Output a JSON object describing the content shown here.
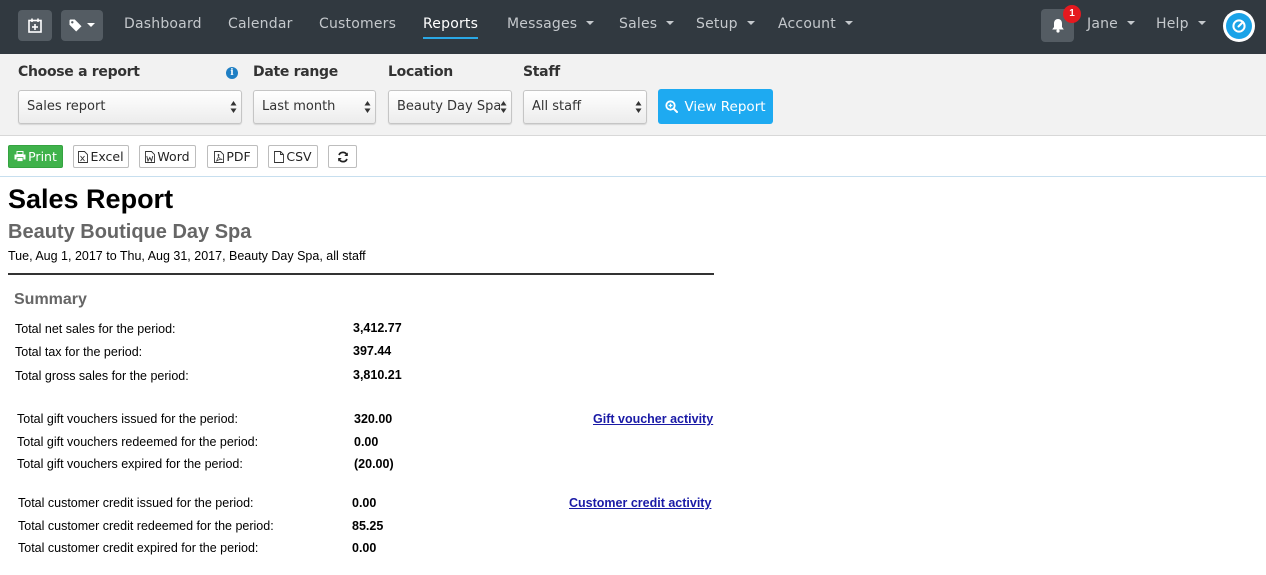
{
  "nav": {
    "items": [
      {
        "label": "Dashboard"
      },
      {
        "label": "Calendar"
      },
      {
        "label": "Customers"
      },
      {
        "label": "Reports",
        "active": true
      },
      {
        "label": "Messages"
      },
      {
        "label": "Sales"
      },
      {
        "label": "Setup"
      },
      {
        "label": "Account"
      }
    ],
    "notification_count": "1",
    "user": "Jane",
    "help": "Help"
  },
  "filters": {
    "report_label": "Choose a report",
    "report_value": "Sales report",
    "date_label": "Date range",
    "date_value": "Last month",
    "location_label": "Location",
    "location_value": "Beauty Day Spa",
    "staff_label": "Staff",
    "staff_value": "All staff",
    "view_button": "View Report"
  },
  "toolbar": {
    "print": "Print",
    "excel": "Excel",
    "word": "Word",
    "pdf": "PDF",
    "csv": "CSV"
  },
  "report": {
    "title": "Sales Report",
    "business": "Beauty Boutique Day Spa",
    "range": "Tue, Aug 1, 2017 to Thu, Aug 31, 2017, Beauty Day Spa, all staff",
    "summary_heading": "Summary",
    "sales": [
      {
        "label": "Total net sales for the period:",
        "value": "3,412.77"
      },
      {
        "label": "Total tax for the period:",
        "value": "397.44"
      },
      {
        "label": "Total gross sales for the period:",
        "value": "3,810.21"
      }
    ],
    "vouchers": [
      {
        "label": "Total gift vouchers issued for the period:",
        "value": "320.00"
      },
      {
        "label": "Total gift vouchers redeemed for the period:",
        "value": "0.00"
      },
      {
        "label": "Total gift vouchers expired for the period:",
        "value": "(20.00)"
      }
    ],
    "voucher_link": "Gift voucher activity",
    "credit": [
      {
        "label": "Total customer credit issued for the period:",
        "value": "0.00"
      },
      {
        "label": "Total customer credit redeemed for the period:",
        "value": "85.25"
      },
      {
        "label": "Total customer credit expired for the period:",
        "value": "0.00"
      }
    ],
    "credit_link": "Customer credit activity"
  },
  "colors": {
    "navbar": "#313940",
    "accent": "#1eaaf1",
    "print_green": "#3fb24b",
    "badge_red": "#e5191f",
    "link": "#1a1aa6"
  },
  "icons": [
    "calendar-add-icon",
    "tag-icon",
    "bell-icon",
    "logo-icon",
    "info-icon",
    "search-icon",
    "print-icon",
    "excel-icon",
    "word-icon",
    "pdf-icon",
    "csv-icon",
    "refresh-icon"
  ]
}
